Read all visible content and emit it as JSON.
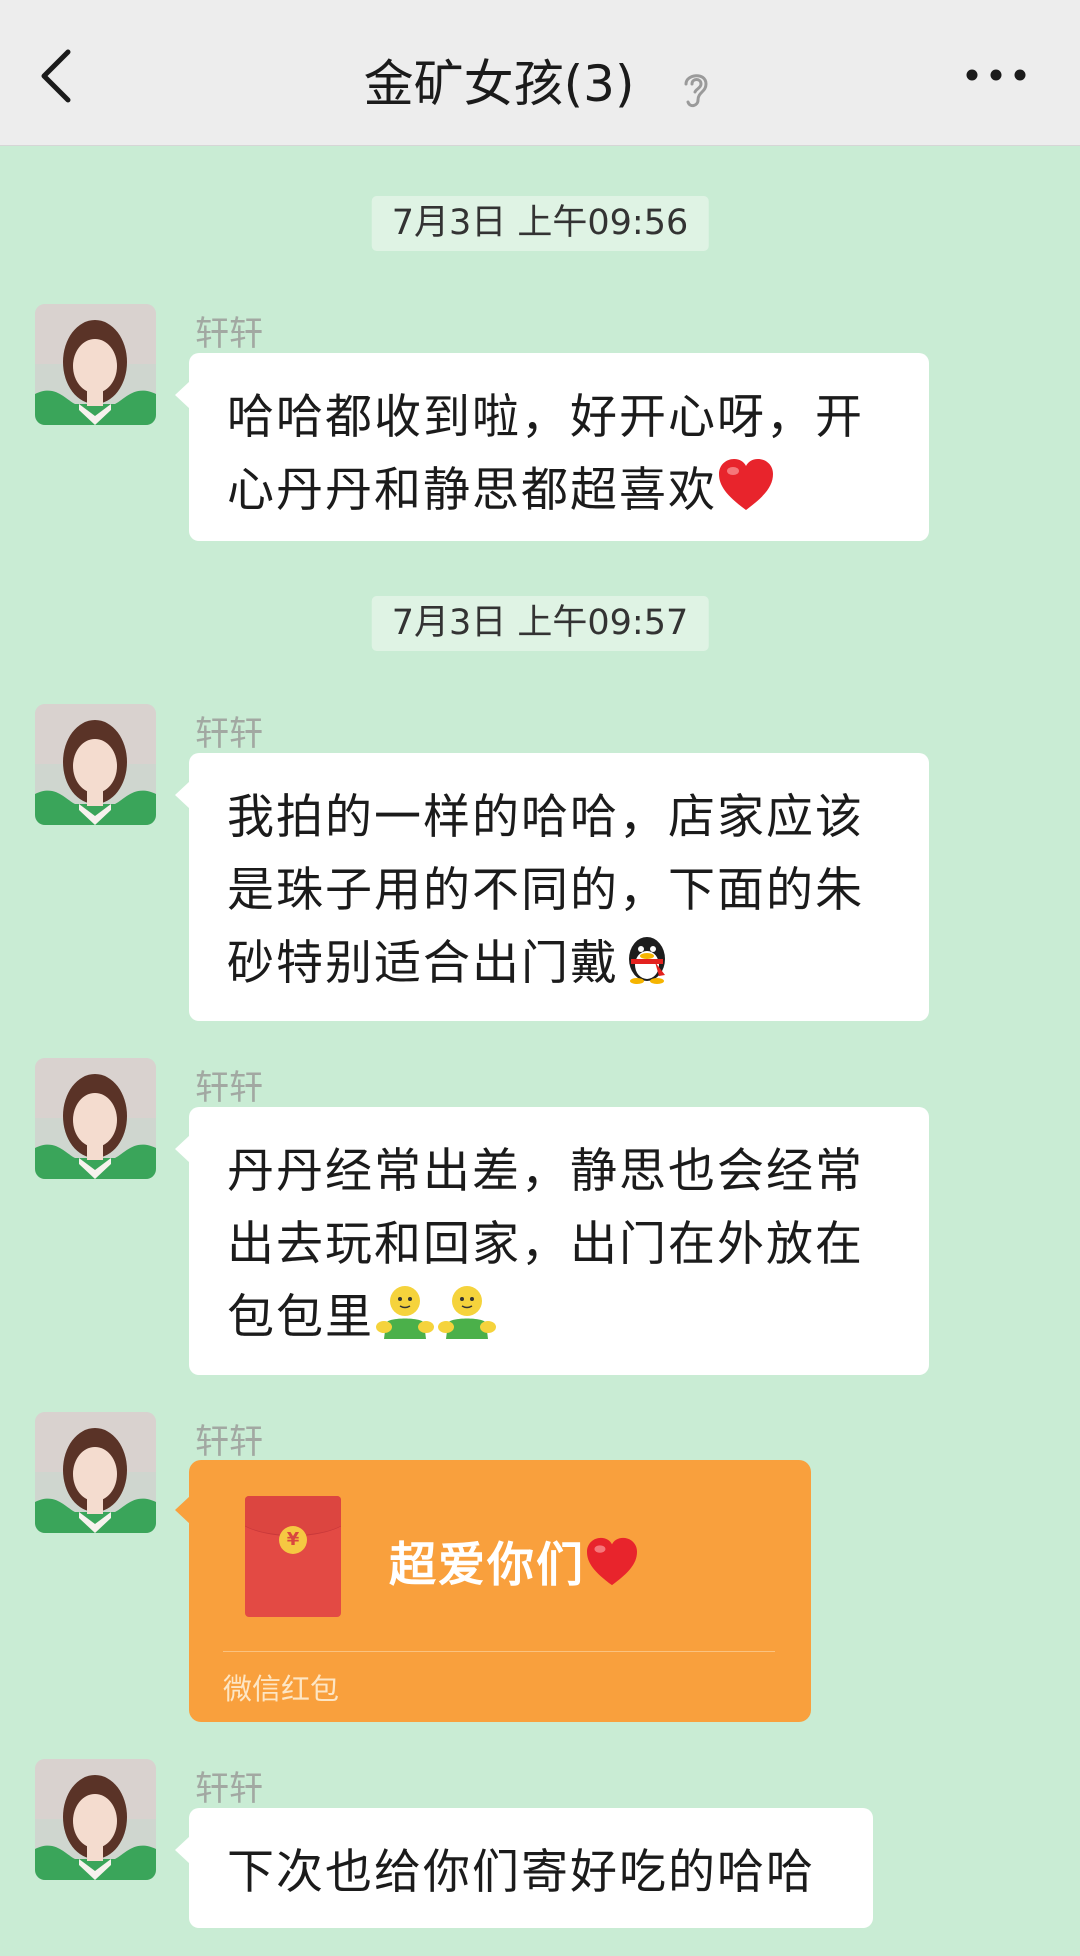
{
  "header": {
    "title": "金矿女孩(3)",
    "mute_icon": "ear-icon",
    "back_icon": "chevron-left-icon",
    "more_icon": "ellipsis-icon"
  },
  "messages": [
    {
      "type": "timestamp",
      "text": "7月3日 上午09:56"
    },
    {
      "type": "text",
      "sender": "轩轩",
      "text": "哈哈都收到啦，好开心呀，开心丹丹和静思都超喜欢"
    },
    {
      "type": "timestamp",
      "text": "7月3日 上午09:57"
    },
    {
      "type": "text",
      "sender": "轩轩",
      "text": "我拍的一样的哈哈，店家应该是珠子用的不同的，下面的朱砂特别适合出门戴"
    },
    {
      "type": "text",
      "sender": "轩轩",
      "text": "丹丹经常出差，静思也会经常出去玩和回家，出门在外放在包包里"
    },
    {
      "type": "red_packet",
      "sender": "轩轩",
      "title": "超爱你们",
      "caption": "微信红包"
    },
    {
      "type": "text",
      "sender": "轩轩",
      "text": "下次也给你们寄好吃的哈哈"
    }
  ],
  "colors": {
    "chat_bg": "#c9ecd4",
    "header_bg": "#ededed",
    "bubble_bg": "#ffffff",
    "red_packet_bg": "#f9a03d"
  }
}
